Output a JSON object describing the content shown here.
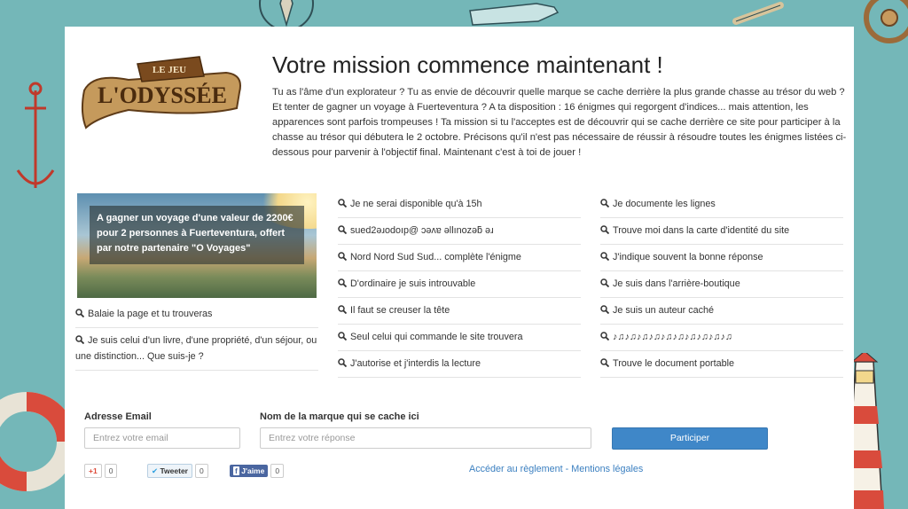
{
  "logo": {
    "top_text": "LE JEU",
    "main_text": "L'ODYSSÉE"
  },
  "title": "Votre mission commence maintenant !",
  "intro": "Tu as l'âme d'un explorateur ? Tu as envie de découvrir quelle marque se cache derrière la plus grande chasse au trésor du web ? Et tenter de gagner un voyage à Fuerteventura ? A ta disposition : 16 énigmes qui regorgent d'indices... mais attention, les apparences sont parfois trompeuses ! Ta mission si tu l'acceptes est de découvrir qui se cache derrière ce site pour participer à la chasse au trésor qui débutera le 2 octobre. Précisons qu'il n'est pas nécessaire de réussir à résoudre toutes les énigmes listées ci-dessous pour parvenir à l'objectif final. Maintenant c'est à toi de jouer !",
  "prize": {
    "text": "A gagner un voyage d'une valeur de 2200€ pour 2 personnes à Fuerteventura, offert par notre partenaire \"O Voyages\""
  },
  "col1": [
    "Balaie la page et tu trouveras",
    "Je suis celui d'un livre, d'une propriété, d'un séjour, ou une distinction... Que suis-je ?"
  ],
  "col2": [
    "Je ne serai disponible qu'à 15h",
    "sued2ǝɹodoıp@ ɔǝʌɐ ǝllınozǝƃ ǝɹ",
    "Nord Nord Sud Sud... complète l'énigme",
    "D'ordinaire je suis introuvable",
    "Il faut se creuser la tête",
    "Seul celui qui commande le site trouvera",
    "J'autorise et j'interdis la lecture"
  ],
  "col3": [
    "Je documente les lignes",
    "Trouve moi dans la carte d'identité du site",
    "J'indique souvent la bonne réponse",
    "Je suis dans l'arrière-boutique",
    "Je suis un auteur caché",
    "♪♫♪♫♪♫♪♫♪♫♪♫♪♫♪♫♪♫♪♫",
    "Trouve le document portable"
  ],
  "form": {
    "email_label": "Adresse Email",
    "email_placeholder": "Entrez votre email",
    "brand_label": "Nom de la marque qui se cache ici",
    "brand_placeholder": "Entrez votre réponse",
    "submit_label": "Participer"
  },
  "social": {
    "gplus_label": "+1",
    "gplus_count": "0",
    "twitter_label": "Tweeter",
    "twitter_count": "0",
    "facebook_label": "J'aime",
    "facebook_count": "0"
  },
  "footer": {
    "rules_link": "Accéder au règlement",
    "separator": " - ",
    "legal_link": "Mentions légales"
  },
  "colors": {
    "background": "#74b7b8",
    "button": "#3f87c8",
    "link": "#3a7fc0"
  }
}
